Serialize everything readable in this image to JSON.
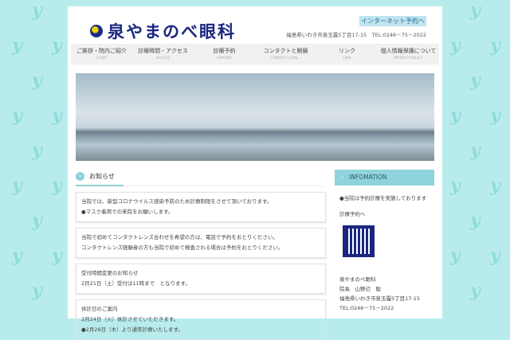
{
  "header": {
    "logo": "泉やまのべ眼科",
    "internet_booking": "インターネット予約へ",
    "address": "福島県いわき市泉玉露5丁目17-15　TEL:0246－75－2022"
  },
  "nav": [
    {
      "ja": "ご挨拶・院内ご紹介",
      "en": "CLINIC"
    },
    {
      "ja": "診療時間・アクセス",
      "en": "ACCESS"
    },
    {
      "ja": "診療予約",
      "en": "APPOINT"
    },
    {
      "ja": "コンタクトと眼鏡",
      "en": "CONTACT LENS..."
    },
    {
      "ja": "リンク",
      "en": "LINK"
    },
    {
      "ja": "個人情報保護について",
      "en": "PRIVACY POLICY"
    }
  ],
  "news": {
    "title": "お知らせ",
    "items": [
      [
        "当院では、新型コロナウイルス感染予防のため診療制限をさせて頂いております。",
        "●マスク着用での来院をお願いします。"
      ],
      [
        "当院で初めてコンタクトレンズ合わせを希望の方は、電話で予約をおとりください。",
        "コンタクトレンズ経験者の方も当院で初めて検査される場合は予約をおとりください。"
      ],
      [
        "受付時間変更のお知らせ",
        "2月21日（土）受付は11時まで　となります。"
      ],
      [
        "休診日のご案内",
        "2月24日（火）休診させていただきます。",
        "●2月26日（木）より通常診療いたします。"
      ]
    ]
  },
  "info": {
    "title": "INFOMATION",
    "note": "●当院は予約診療を実施しております",
    "link": "診療予約へ",
    "lines": [
      "泉やまのべ眼科",
      "院長　山野辺　聡",
      "福島県いわき市泉玉露5丁目17-15",
      "TEL:0246－75－2022"
    ]
  }
}
